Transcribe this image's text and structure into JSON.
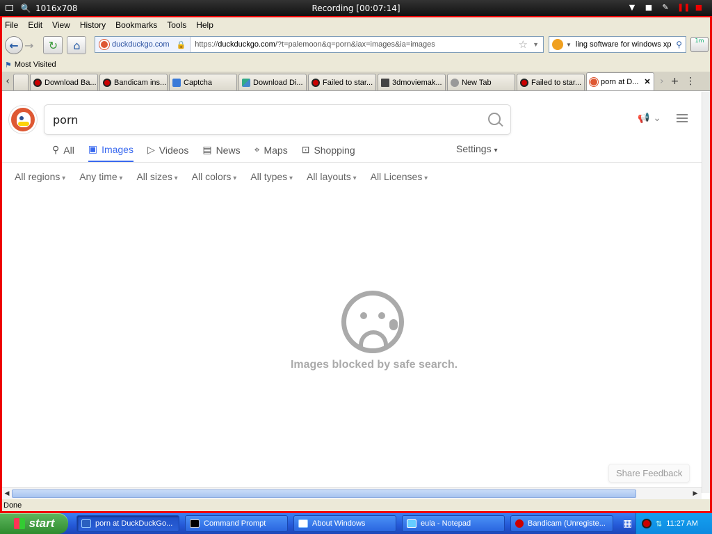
{
  "recorder": {
    "resolution": "1016x708",
    "title": "Recording [00:07:14]"
  },
  "menu": {
    "items": [
      "File",
      "Edit",
      "View",
      "History",
      "Bookmarks",
      "Tools",
      "Help"
    ]
  },
  "nav": {
    "site_identity": "duckduckgo.com",
    "url_prefix": "https://",
    "url_host": "duckduckgo.com",
    "url_path": "/?t=palemoon&q=porn&iax=images&ia=images",
    "search_value": "ling software for windows xp",
    "ext_label": "1m"
  },
  "bookmarks": {
    "most_visited": "Most Visited"
  },
  "tabs": [
    {
      "label": "Download Ba...",
      "icon": "recording-icon"
    },
    {
      "label": "Bandicam ins...",
      "icon": "recording-icon"
    },
    {
      "label": "Captcha",
      "icon": "captcha-icon"
    },
    {
      "label": "Download Di...",
      "icon": "download-icon"
    },
    {
      "label": "Failed to star...",
      "icon": "recording-icon"
    },
    {
      "label": "3dmoviemak...",
      "icon": "movie-icon"
    },
    {
      "label": "New Tab",
      "icon": "globe-icon"
    },
    {
      "label": "Failed to star...",
      "icon": "recording-icon"
    },
    {
      "label": "porn at D...",
      "icon": "duckduckgo-icon",
      "active": true
    }
  ],
  "ddg": {
    "query": "porn",
    "nav_tabs": [
      "All",
      "Images",
      "Videos",
      "News",
      "Maps",
      "Shopping"
    ],
    "active_tab": "Images",
    "settings": "Settings",
    "filters": [
      "All regions",
      "Any time",
      "All sizes",
      "All colors",
      "All types",
      "All layouts",
      "All Licenses"
    ],
    "blocked_message": "Images blocked by safe search.",
    "feedback": "Share Feedback"
  },
  "status": {
    "text": "Done"
  },
  "taskbar": {
    "start": "start",
    "tasks": [
      {
        "label": "porn at DuckDuckGo...",
        "active": true
      },
      {
        "label": "Command Prompt",
        "active": false
      },
      {
        "label": "About Windows",
        "active": false
      },
      {
        "label": "eula - Notepad",
        "active": false
      },
      {
        "label": "Bandicam (Unregiste...",
        "active": false
      }
    ],
    "clock": "11:27 AM"
  },
  "colors": {
    "accent": "#3969ef",
    "ddg_brand": "#de5833",
    "recording_border": "#ee0000"
  }
}
